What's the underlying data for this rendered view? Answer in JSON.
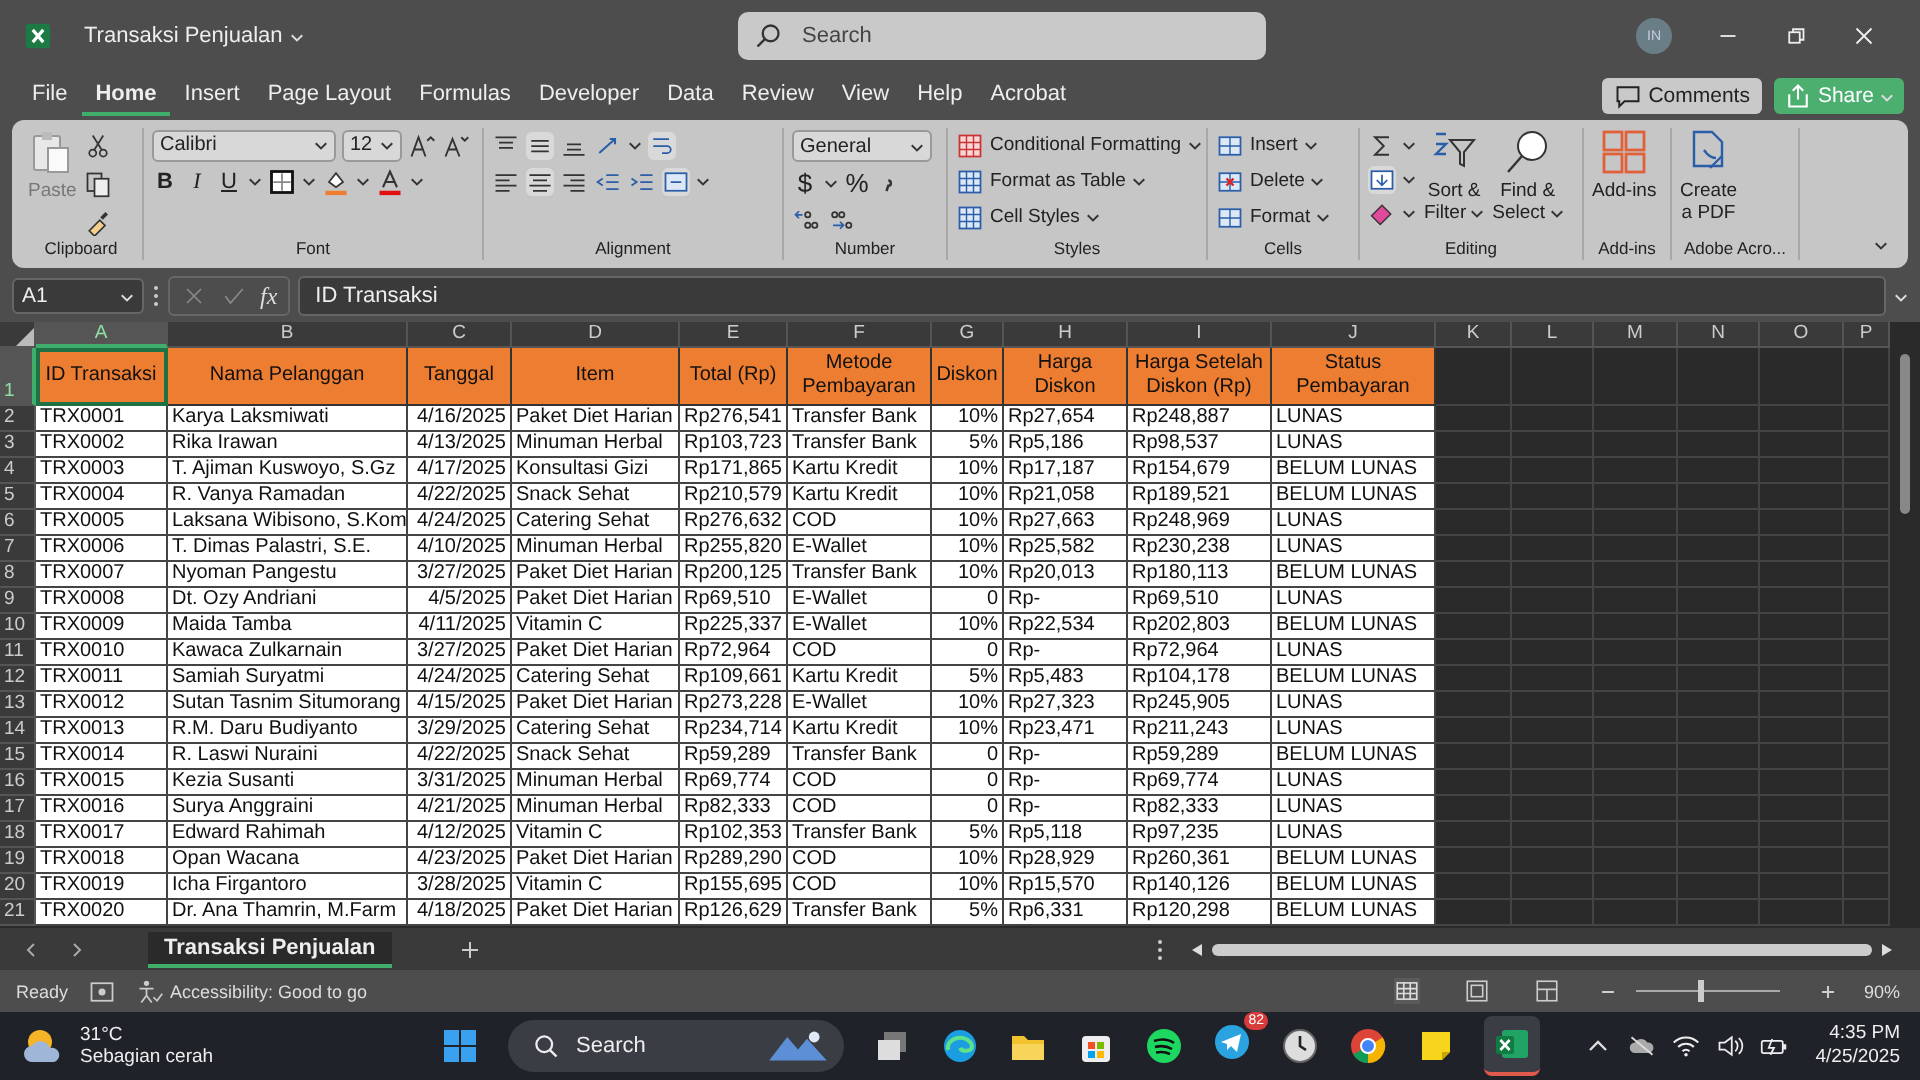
{
  "window": {
    "title": "Transaksi Penjualan",
    "search_placeholder": "Search",
    "user_initials": "IN"
  },
  "menu": [
    {
      "label": "File",
      "selected": false
    },
    {
      "label": "Home",
      "selected": true
    },
    {
      "label": "Insert",
      "selected": false
    },
    {
      "label": "Page Layout",
      "selected": false
    },
    {
      "label": "Formulas",
      "selected": false
    },
    {
      "label": "Developer",
      "selected": false
    },
    {
      "label": "Data",
      "selected": false
    },
    {
      "label": "Review",
      "selected": false
    },
    {
      "label": "View",
      "selected": false
    },
    {
      "label": "Help",
      "selected": false
    },
    {
      "label": "Acrobat",
      "selected": false
    }
  ],
  "actions": {
    "comments": "Comments",
    "share": "Share"
  },
  "ribbon": {
    "clipboard": {
      "paste": "Paste",
      "label": "Clipboard"
    },
    "font": {
      "name": "Calibri",
      "size": "12",
      "bold": "B",
      "italic": "I",
      "underline": "U",
      "label": "Font"
    },
    "alignment": {
      "label": "Alignment"
    },
    "number": {
      "format": "General",
      "currency": "$",
      "percent": "%",
      "label": "Number"
    },
    "styles": {
      "items": [
        "Conditional Formatting",
        "Format as Table",
        "Cell Styles"
      ],
      "label": "Styles"
    },
    "cells": {
      "items": [
        "Insert",
        "Delete",
        "Format"
      ],
      "label": "Cells"
    },
    "editing": {
      "sort_filter": [
        "Sort &",
        "Filter"
      ],
      "find_select": [
        "Find &",
        "Select"
      ],
      "label": "Editing"
    },
    "addins": {
      "button": "Add-ins",
      "label": "Add-ins"
    },
    "adobe": {
      "button": [
        "Create",
        "a PDF"
      ],
      "label": "Adobe Acro..."
    }
  },
  "formula_bar": {
    "name_box": "A1",
    "fx": "fx",
    "value": "ID Transaksi"
  },
  "sheet": {
    "column_letters": [
      {
        "label": "A",
        "selected": true
      },
      {
        "label": "B",
        "selected": false
      },
      {
        "label": "C",
        "selected": false
      },
      {
        "label": "D",
        "selected": false
      },
      {
        "label": "E",
        "selected": false
      },
      {
        "label": "F",
        "selected": false
      },
      {
        "label": "G",
        "selected": false
      },
      {
        "label": "H",
        "selected": false
      },
      {
        "label": "I",
        "selected": false
      },
      {
        "label": "J",
        "selected": false
      },
      {
        "label": "K",
        "selected": false
      },
      {
        "label": "L",
        "selected": false
      },
      {
        "label": "M",
        "selected": false
      },
      {
        "label": "N",
        "selected": false
      },
      {
        "label": "O",
        "selected": false
      },
      {
        "label": "P",
        "selected": false
      }
    ],
    "row_numbers": [
      {
        "label": "1",
        "selected": true
      },
      {
        "label": "2",
        "selected": false
      },
      {
        "label": "3",
        "selected": false
      },
      {
        "label": "4",
        "selected": false
      },
      {
        "label": "5",
        "selected": false
      },
      {
        "label": "6",
        "selected": false
      },
      {
        "label": "7",
        "selected": false
      },
      {
        "label": "8",
        "selected": false
      },
      {
        "label": "9",
        "selected": false
      },
      {
        "label": "10",
        "selected": false
      },
      {
        "label": "11",
        "selected": false
      },
      {
        "label": "12",
        "selected": false
      },
      {
        "label": "13",
        "selected": false
      },
      {
        "label": "14",
        "selected": false
      },
      {
        "label": "15",
        "selected": false
      },
      {
        "label": "16",
        "selected": false
      },
      {
        "label": "17",
        "selected": false
      },
      {
        "label": "18",
        "selected": false
      },
      {
        "label": "19",
        "selected": false
      },
      {
        "label": "20",
        "selected": false
      },
      {
        "label": "21",
        "selected": false
      }
    ],
    "headers": [
      {
        "text": "ID Transaksi",
        "selected": true
      },
      {
        "text": "Nama Pelanggan",
        "selected": false
      },
      {
        "text": "Tanggal",
        "selected": false
      },
      {
        "text": "Item",
        "selected": false
      },
      {
        "text": "Total (Rp)",
        "selected": false
      },
      {
        "text": "Metode Pembayaran",
        "selected": false
      },
      {
        "text": "Diskon",
        "selected": false
      },
      {
        "text": "Harga Diskon",
        "selected": false
      },
      {
        "text": "Harga Setelah Diskon (Rp)",
        "selected": false
      },
      {
        "text": "Status Pembayaran",
        "selected": false
      }
    ],
    "rows": [
      [
        "TRX0001",
        "Karya Laksmiwati",
        "4/16/2025",
        "Paket Diet Harian",
        "Rp276,541",
        "Transfer Bank",
        "10%",
        "Rp27,654",
        "Rp248,887",
        "LUNAS"
      ],
      [
        "TRX0002",
        "Rika Irawan",
        "4/13/2025",
        "Minuman Herbal",
        "Rp103,723",
        "Transfer Bank",
        "5%",
        "Rp5,186",
        "Rp98,537",
        "LUNAS"
      ],
      [
        "TRX0003",
        "T. Ajiman Kuswoyo, S.Gz",
        "4/17/2025",
        "Konsultasi Gizi",
        "Rp171,865",
        "Kartu Kredit",
        "10%",
        "Rp17,187",
        "Rp154,679",
        "BELUM LUNAS"
      ],
      [
        "TRX0004",
        "R. Vanya Ramadan",
        "4/22/2025",
        "Snack Sehat",
        "Rp210,579",
        "Kartu Kredit",
        "10%",
        "Rp21,058",
        "Rp189,521",
        "BELUM LUNAS"
      ],
      [
        "TRX0005",
        "Laksana Wibisono, S.Kom",
        "4/24/2025",
        "Catering Sehat",
        "Rp276,632",
        "COD",
        "10%",
        "Rp27,663",
        "Rp248,969",
        "LUNAS"
      ],
      [
        "TRX0006",
        "T. Dimas Palastri, S.E.",
        "4/10/2025",
        "Minuman Herbal",
        "Rp255,820",
        "E-Wallet",
        "10%",
        "Rp25,582",
        "Rp230,238",
        "LUNAS"
      ],
      [
        "TRX0007",
        "Nyoman Pangestu",
        "3/27/2025",
        "Paket Diet Harian",
        "Rp200,125",
        "Transfer Bank",
        "10%",
        "Rp20,013",
        "Rp180,113",
        "BELUM LUNAS"
      ],
      [
        "TRX0008",
        "Dt. Ozy Andriani",
        "4/5/2025",
        "Paket Diet Harian",
        "Rp69,510",
        "E-Wallet",
        "0",
        "Rp-",
        "Rp69,510",
        "LUNAS"
      ],
      [
        "TRX0009",
        "Maida Tamba",
        "4/11/2025",
        "Vitamin C",
        "Rp225,337",
        "E-Wallet",
        "10%",
        "Rp22,534",
        "Rp202,803",
        "BELUM LUNAS"
      ],
      [
        "TRX0010",
        "Kawaca Zulkarnain",
        "3/27/2025",
        "Paket Diet Harian",
        "Rp72,964",
        "COD",
        "0",
        "Rp-",
        "Rp72,964",
        "LUNAS"
      ],
      [
        "TRX0011",
        "Samiah Suryatmi",
        "4/24/2025",
        "Catering Sehat",
        "Rp109,661",
        "Kartu Kredit",
        "5%",
        "Rp5,483",
        "Rp104,178",
        "BELUM LUNAS"
      ],
      [
        "TRX0012",
        "Sutan Tasnim Situmorang",
        "4/15/2025",
        "Paket Diet Harian",
        "Rp273,228",
        "E-Wallet",
        "10%",
        "Rp27,323",
        "Rp245,905",
        "LUNAS"
      ],
      [
        "TRX0013",
        "R.M. Daru Budiyanto",
        "3/29/2025",
        "Catering Sehat",
        "Rp234,714",
        "Kartu Kredit",
        "10%",
        "Rp23,471",
        "Rp211,243",
        "LUNAS"
      ],
      [
        "TRX0014",
        "R. Laswi Nuraini",
        "4/22/2025",
        "Snack Sehat",
        "Rp59,289",
        "Transfer Bank",
        "0",
        "Rp-",
        "Rp59,289",
        "BELUM LUNAS"
      ],
      [
        "TRX0015",
        "Kezia Susanti",
        "3/31/2025",
        "Minuman Herbal",
        "Rp69,774",
        "COD",
        "0",
        "Rp-",
        "Rp69,774",
        "LUNAS"
      ],
      [
        "TRX0016",
        "Surya Anggraini",
        "4/21/2025",
        "Minuman Herbal",
        "Rp82,333",
        "COD",
        "0",
        "Rp-",
        "Rp82,333",
        "LUNAS"
      ],
      [
        "TRX0017",
        "Edward Rahimah",
        "4/12/2025",
        "Vitamin C",
        "Rp102,353",
        "Transfer Bank",
        "5%",
        "Rp5,118",
        "Rp97,235",
        "LUNAS"
      ],
      [
        "TRX0018",
        "Opan Wacana",
        "4/23/2025",
        "Paket Diet Harian",
        "Rp289,290",
        "COD",
        "10%",
        "Rp28,929",
        "Rp260,361",
        "BELUM LUNAS"
      ],
      [
        "TRX0019",
        "Icha Firgantoro",
        "3/28/2025",
        "Vitamin C",
        "Rp155,695",
        "COD",
        "10%",
        "Rp15,570",
        "Rp140,126",
        "BELUM LUNAS"
      ],
      [
        "TRX0020",
        "Dr. Ana Thamrin, M.Farm",
        "4/18/2025",
        "Paket Diet Harian",
        "Rp126,629",
        "Transfer Bank",
        "5%",
        "Rp6,331",
        "Rp120,298",
        "BELUM LUNAS"
      ]
    ]
  },
  "sheet_tabs": [
    {
      "label": "Transaksi Penjualan",
      "selected": true
    }
  ],
  "status_bar": {
    "ready": "Ready",
    "accessibility": "Accessibility: Good to go",
    "zoom_slider": {
      "level": 0.43
    },
    "zoom": "90%"
  },
  "taskbar": {
    "weather_temp": "31°C",
    "weather_desc": "Sebagian cerah",
    "search": "Search",
    "telegram_badge": "82",
    "time": "4:35 PM",
    "date": "4/25/2025"
  }
}
